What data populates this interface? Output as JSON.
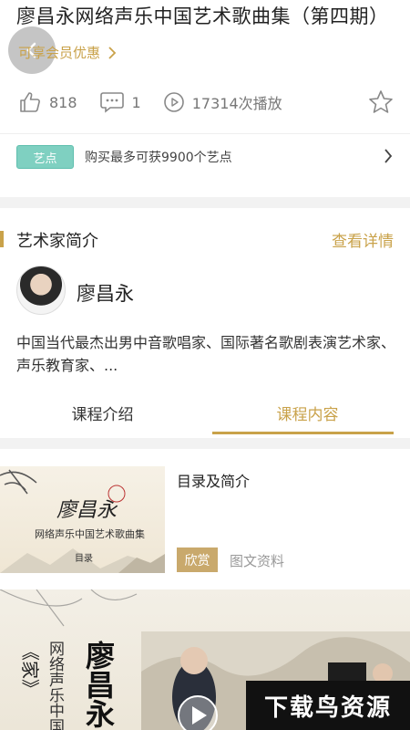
{
  "header": {
    "title": "廖昌永网络声乐中国艺术歌曲集（第四期）",
    "vip_label": "可享会员优惠",
    "back_icon": "chevron-left-icon"
  },
  "stats": {
    "likes": "818",
    "comments": "1",
    "plays": "17314次播放"
  },
  "points": {
    "badge": "艺点",
    "text": "购买最多可获9900个艺点"
  },
  "artist_section": {
    "title": "艺术家简介",
    "detail_link": "查看详情",
    "name": "廖昌永",
    "description": "中国当代最杰出男中音歌唱家、国际著名歌剧表演艺术家、声乐教育家、..."
  },
  "tabs": [
    {
      "label": "课程介绍",
      "active": false
    },
    {
      "label": "课程内容",
      "active": true
    }
  ],
  "course_item": {
    "title": "目录及简介",
    "tag_primary": "欣赏",
    "tag_secondary": "图文资料",
    "thumb_text_name": "廖昌永",
    "thumb_text_sub": "网络声乐中国艺术歌曲集",
    "thumb_text_label": "目录"
  },
  "banner": {
    "book_title": "《家》",
    "vertical_caption": "网络声乐中国",
    "vertical_name": "廖昌永"
  },
  "watermark": "下载鸟资源",
  "colors": {
    "accent": "#c9a24a",
    "badge_teal": "#7fd0c1",
    "tag_gold": "#c9a96c"
  }
}
